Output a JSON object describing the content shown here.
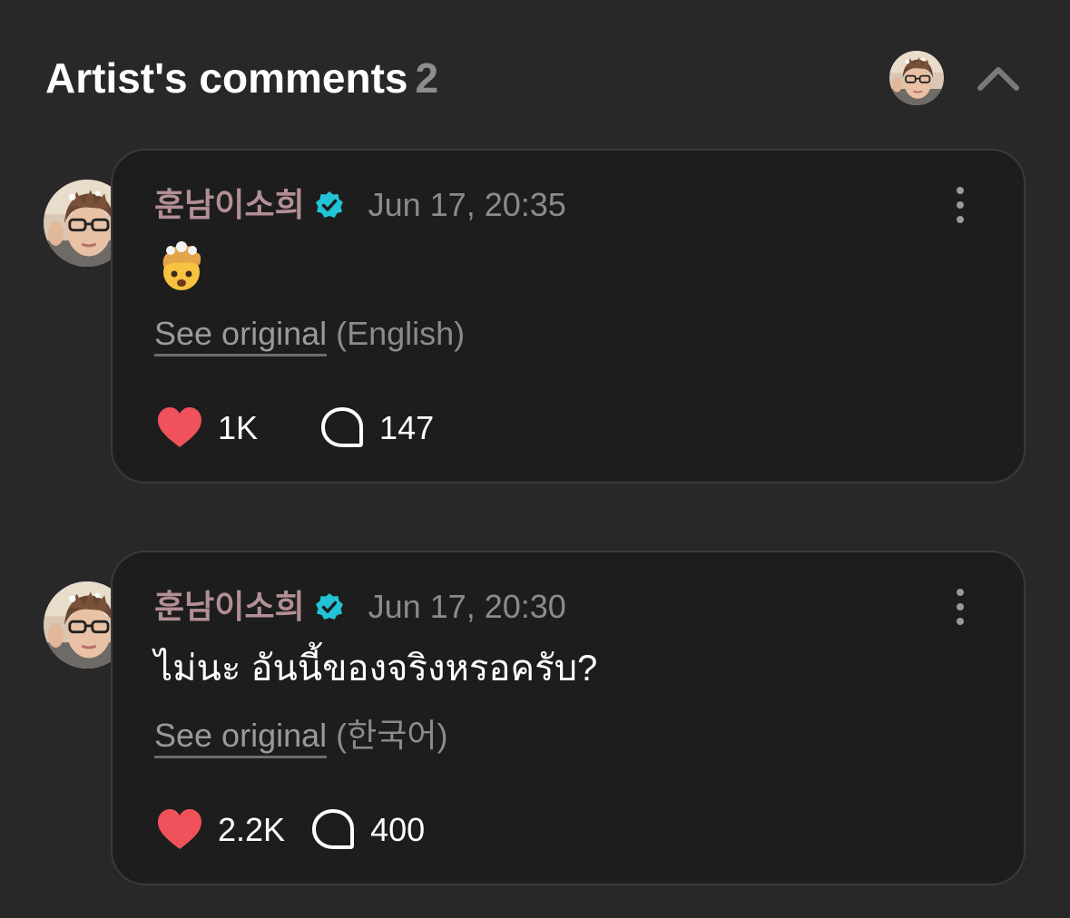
{
  "header": {
    "title": "Artist's comments",
    "count": "2"
  },
  "colors": {
    "background": "#282828",
    "card": "#1d1d1d",
    "username": "#b28f95",
    "verified": "#21c4d6",
    "like": "#f0525c"
  },
  "comments": [
    {
      "username": "훈남이소희",
      "timestamp": "Jun 17, 20:35",
      "body": "🤯",
      "body_kind": "emoji",
      "see_original": "See original",
      "language": "(English)",
      "likes": "1K",
      "replies": "147"
    },
    {
      "username": "훈남이소희",
      "timestamp": "Jun 17, 20:30",
      "body": "ไม่นะ อันนี้ของจริงหรอครับ?",
      "body_kind": "text",
      "see_original": "See original",
      "language": "(한국어)",
      "likes": "2.2K",
      "replies": "400"
    }
  ],
  "icons": {
    "collapse": "chevron-up-icon",
    "more": "more-vertical-icon",
    "verified": "verified-badge-icon",
    "like": "heart-icon",
    "reply": "comment-bubble-icon",
    "emoji": "exploding-head-emoji"
  }
}
